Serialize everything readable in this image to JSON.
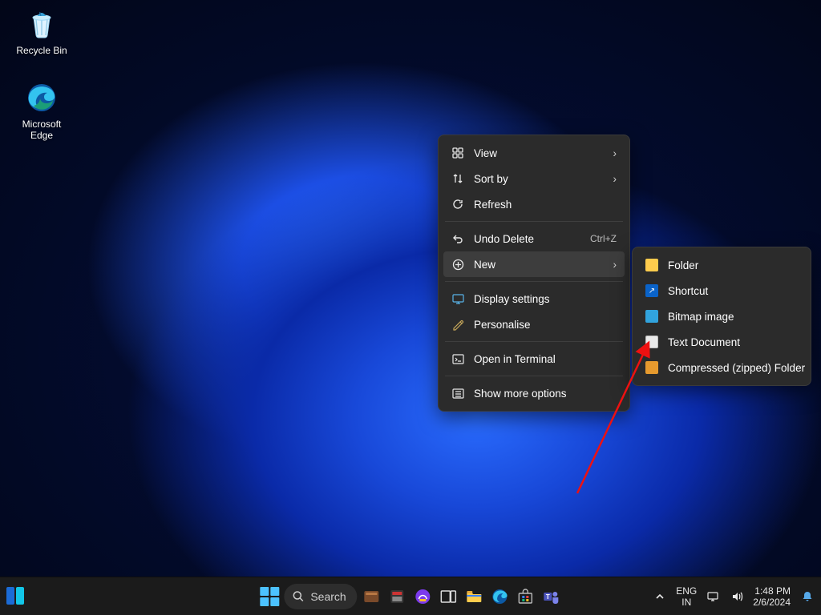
{
  "desktop_icons": {
    "recycle_bin": "Recycle Bin",
    "edge": "Microsoft Edge"
  },
  "context_menu": {
    "view": "View",
    "sort_by": "Sort by",
    "refresh": "Refresh",
    "undo_delete": "Undo Delete",
    "undo_delete_hint": "Ctrl+Z",
    "new": "New",
    "display_settings": "Display settings",
    "personalise": "Personalise",
    "open_terminal": "Open in Terminal",
    "show_more": "Show more options"
  },
  "new_submenu": {
    "folder": "Folder",
    "shortcut": "Shortcut",
    "bitmap": "Bitmap image",
    "text_doc": "Text Document",
    "zipped": "Compressed (zipped) Folder"
  },
  "taskbar": {
    "search_placeholder": "Search",
    "language_top": "ENG",
    "language_bottom": "IN",
    "clock_time": "1:48 PM",
    "clock_date": "2/6/2024"
  }
}
